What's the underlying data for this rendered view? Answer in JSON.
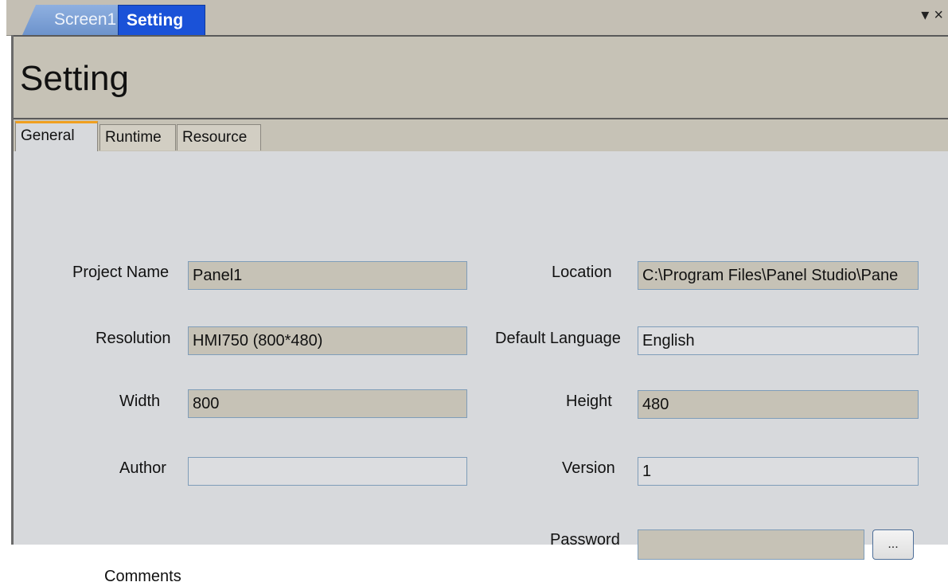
{
  "doc_tabs": {
    "screen1": "Screen1",
    "setting": "Setting"
  },
  "strip_controls": "▾×",
  "header": {
    "title": "Setting"
  },
  "subtabs": {
    "general": "General",
    "runtime": "Runtime",
    "resource": "Resource"
  },
  "fields": {
    "project_name_label": "Project Name",
    "project_name_value": "Panel1",
    "location_label": "Location",
    "location_value": "C:\\Program Files\\Panel Studio\\Pane",
    "resolution_label": "Resolution",
    "resolution_value": "HMI750 (800*480)",
    "default_language_label": "Default Language",
    "default_language_value": "English",
    "width_label": "Width",
    "width_value": "800",
    "height_label": "Height",
    "height_value": "480",
    "author_label": "Author",
    "author_value": "",
    "version_label": "Version",
    "version_value": "1",
    "password_label": "Password",
    "password_value": "",
    "password_button": "...",
    "comments_label": "Comments"
  },
  "colors": {
    "active_doc_tab": "#1a52d8",
    "header_bg": "#c6c2b6",
    "content_bg": "#d7d9dc",
    "active_subtab_accent": "#f0a020"
  }
}
